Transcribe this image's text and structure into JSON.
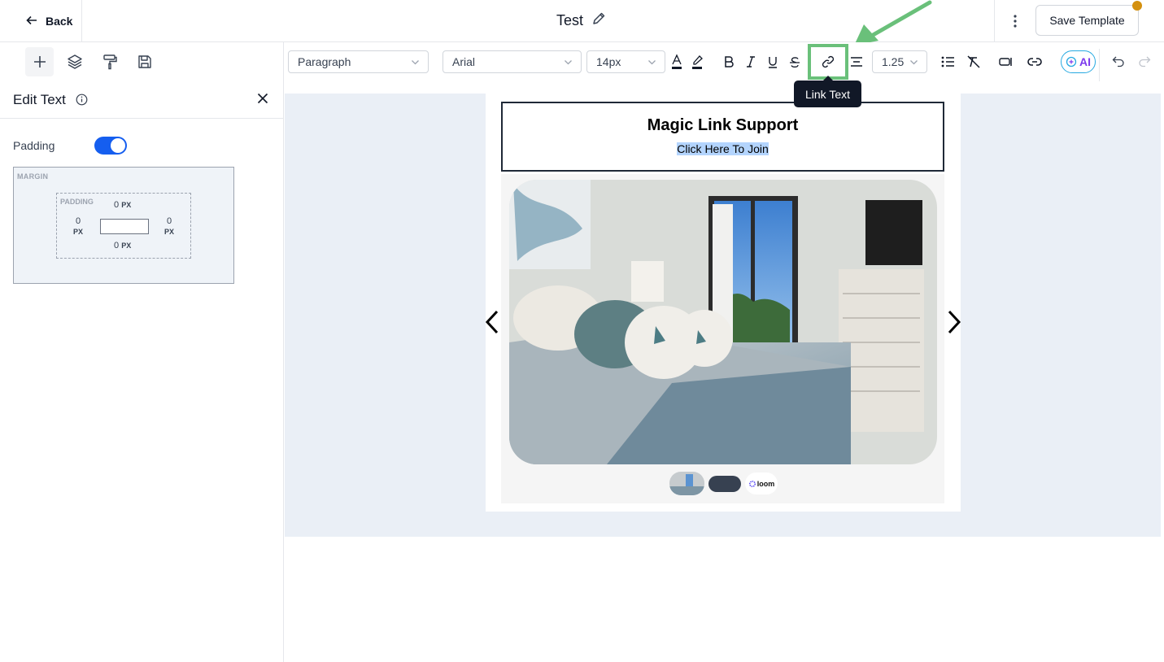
{
  "header": {
    "back_label": "Back",
    "title": "Test",
    "save_label": "Save Template"
  },
  "sidebar": {
    "tools": [
      "add-icon",
      "layers-icon",
      "paint-roller-icon",
      "save-disk-icon"
    ],
    "panel_title": "Edit Text",
    "padding_label": "Padding",
    "padding_enabled": true,
    "margin_label": "MARGIN",
    "padding_box_label": "PADDING",
    "padding_top": "0",
    "padding_bottom": "0",
    "padding_left": "0",
    "padding_right": "0",
    "unit": "PX"
  },
  "toolbar": {
    "block_type": "Paragraph",
    "font": "Arial",
    "font_size": "14px",
    "line_height": "1.25",
    "ai_label": "AI",
    "tooltip": "Link Text"
  },
  "email": {
    "heading": "Magic Link Support",
    "link_text": "Click Here To Join",
    "loom_label": "loom"
  },
  "colors": {
    "accent_blue": "#155eef",
    "highlight_green": "#6ac07a",
    "canvas_bg": "#eaeff6",
    "notify_dot": "#d4900e"
  }
}
